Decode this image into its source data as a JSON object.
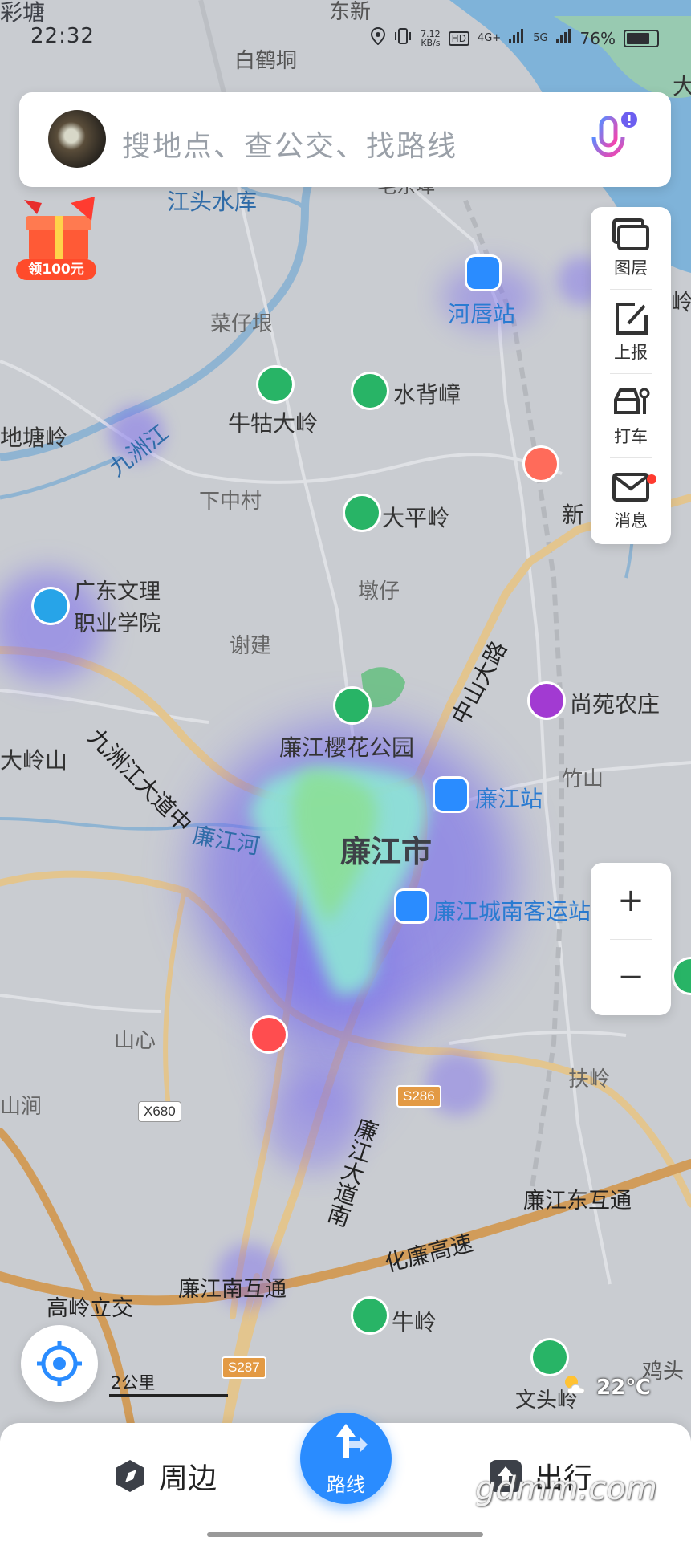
{
  "status_bar": {
    "time": "22:32",
    "net_speed": "7.12\nKB/s",
    "hd": "HD",
    "signal1": "4G+",
    "signal2": "5G",
    "battery": "76%"
  },
  "search": {
    "placeholder": "搜地点、查公交、找路线",
    "mic_icon": "microphone-icon"
  },
  "promo": {
    "label": "领100元"
  },
  "tools": [
    {
      "label": "图层",
      "icon": "layers-icon"
    },
    {
      "label": "上报",
      "icon": "report-icon"
    },
    {
      "label": "打车",
      "icon": "taxi-icon"
    },
    {
      "label": "消息",
      "icon": "mail-icon"
    }
  ],
  "zoom": {
    "in": "+",
    "out": "−"
  },
  "map_labels": {
    "top_left_fragment": "彩塘",
    "dongxin": "东新",
    "baihedong": "白鹤垌",
    "jiangtou_reservoir": "江头水库",
    "maochong": "毛东埠",
    "caizailang": "菜仔垠",
    "heju_station": "河唇站",
    "niugudaling": "牛牯大岭",
    "shuibeizhang": "水背嶂",
    "jiuzhoujiang": "九洲江",
    "ditangling": "地塘岭",
    "xiazhongcun": "下中村",
    "dapingling": "大平岭",
    "xin": "新",
    "gdwl_college": "广东文理\n职业学院",
    "dunzai": "墩仔",
    "xiejian": "谢建",
    "zhongshan_road": "中山大路",
    "shangyuan_farm": "尚苑农庄",
    "jiuzhou_avenue": "九洲江大道中",
    "sakura_park": "廉江樱花公园",
    "dalingshan": "大岭山",
    "lianjiang_station": "廉江站",
    "zhushan": "竹山",
    "lianjiang_river": "廉江河",
    "city": "廉江市",
    "bus_terminal": "廉江城南客运站",
    "shanxin": "山心",
    "x680": "X680",
    "s286": "S286",
    "fuling": "扶岭",
    "shanjian": "山涧",
    "lianjiang_avenue_south": "廉江大道南",
    "east_interchange": "廉江东互通",
    "hualian_expressway": "化廉高速",
    "gaoling_interchange": "高岭立交",
    "south_interchange": "廉江南互通",
    "niuling": "牛岭",
    "s287": "S287",
    "jitou": "鸡头",
    "wentouling": "文头岭",
    "ling_fragment": "岭",
    "tai_fragment": "大"
  },
  "scale": "2公里",
  "weather": {
    "temp": "22℃",
    "icon": "partly-cloudy-icon"
  },
  "bottom_nav": {
    "nearby": "周边",
    "route": "路线",
    "trip": "出行"
  },
  "watermark": "gdmm.com",
  "colors": {
    "accent": "#2a8cff",
    "map_bg": "#c9ccd1",
    "water": "#7fb3d9",
    "road": "#d6a867",
    "heat_purple": "#7b6cf0",
    "heat_core": "#8ee6d6",
    "poi_green": "#28b466"
  }
}
